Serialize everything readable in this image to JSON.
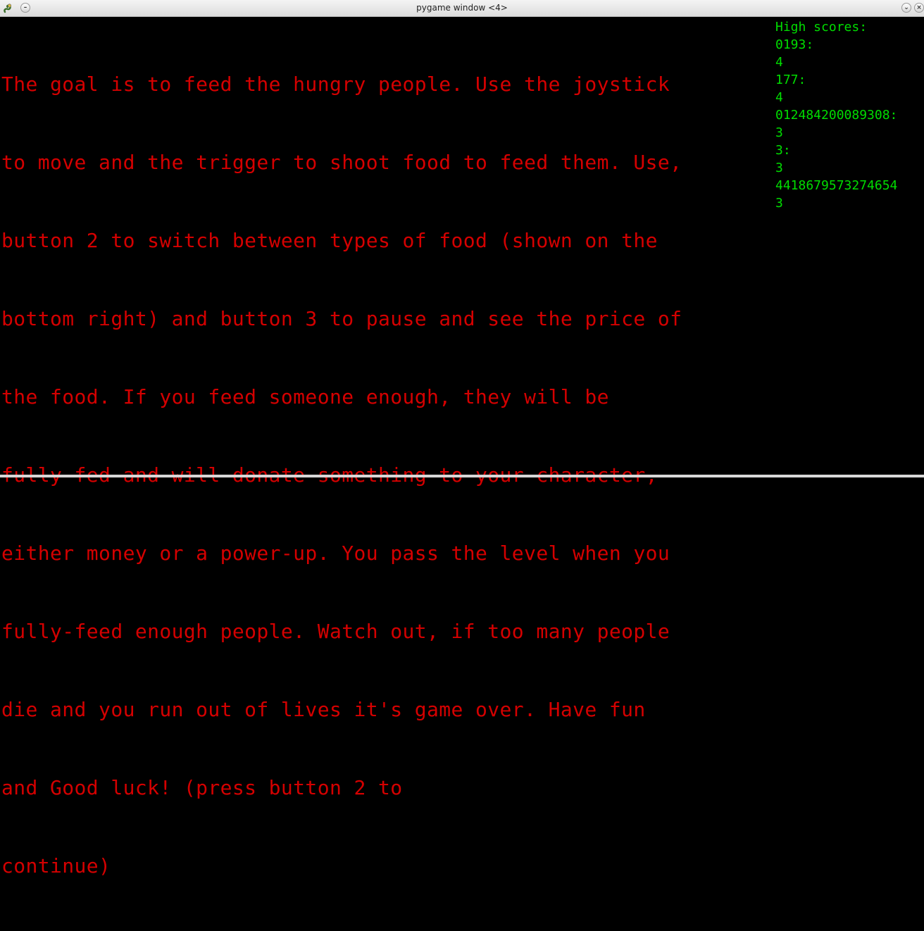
{
  "window": {
    "title": "pygame window <4>",
    "icon": "pygame-snake-icon",
    "menu_button": "menu-icon",
    "minimize_button": "chevron-down-icon",
    "close_button": "close-icon"
  },
  "instructions": {
    "lines": [
      "The goal is to feed the hungry people. Use the joystick",
      "to move and the trigger to shoot food to feed them. Use,",
      "button 2 to switch between types of food (shown on the",
      "bottom right) and button 3 to pause and see the price of",
      "the food. If you feed someone enough, they will be",
      "fully-fed and will donate something to your character,",
      "either money or a power-up. You pass the level when you",
      "fully-feed enough people. Watch out, if too many people",
      "die and you run out of lives it's game over. Have fun",
      "and Good luck! (press button 2 to",
      "continue)"
    ]
  },
  "high_scores": {
    "title": "High scores:",
    "entries": [
      {
        "name": "0193:",
        "score": "4"
      },
      {
        "name": "177:",
        "score": "4"
      },
      {
        "name": "012484200089308:",
        "score": "3"
      },
      {
        "name": "3:",
        "score": "3"
      },
      {
        "name": "4418679573274654",
        "score": "3"
      }
    ]
  },
  "colors": {
    "instruction_text": "#d40000",
    "high_score_text": "#00dd00",
    "background": "#000000"
  }
}
